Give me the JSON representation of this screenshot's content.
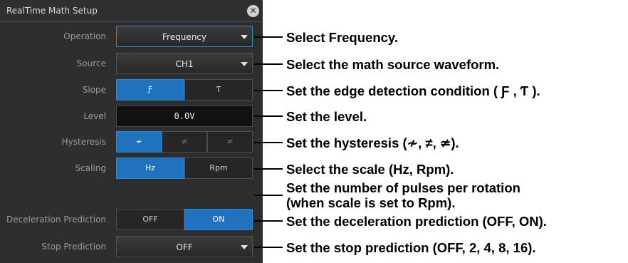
{
  "dialog": {
    "title": "RealTime Math Setup",
    "close_icon": "close-icon"
  },
  "fields": {
    "operation": {
      "label": "Operation",
      "value": "Frequency"
    },
    "source": {
      "label": "Source",
      "value": "CH1"
    },
    "slope": {
      "label": "Slope",
      "options": [
        "Ƒ",
        "Ƭ"
      ],
      "selected": 0
    },
    "level": {
      "label": "Level",
      "value": "0.0V"
    },
    "hysteresis": {
      "label": "Hysteresis",
      "options": [
        "≁",
        "≠",
        "≄"
      ],
      "selected": 0
    },
    "scaling": {
      "label": "Scaling",
      "options": [
        "Hz",
        "Rpm"
      ],
      "selected": 0
    },
    "decel": {
      "label": "Deceleration Prediction",
      "options": [
        "OFF",
        "ON"
      ],
      "selected": 1
    },
    "stop": {
      "label": "Stop Prediction",
      "value": "OFF"
    }
  },
  "annotations": {
    "operation": "Select Frequency.",
    "source": "Select the math source waveform.",
    "slope": "Set the edge detection condition ( Ƒ , Ƭ ).",
    "level": "Set the level.",
    "hysteresis": "Set the hysteresis (≁, ≠, ≄).",
    "scaling": "Select the scale (Hz, Rpm).",
    "pulses_line1": "Set the number of pulses per rotation",
    "pulses_line2": "(when scale is set to Rpm).",
    "decel": "Set the deceleration prediction (OFF, ON).",
    "stop": "Set the stop prediction (OFF, 2, 4, 8, 16)."
  },
  "colors": {
    "panel_bg": "#2e2e2e",
    "accent": "#1f72be",
    "annotation_text": "#000000"
  }
}
